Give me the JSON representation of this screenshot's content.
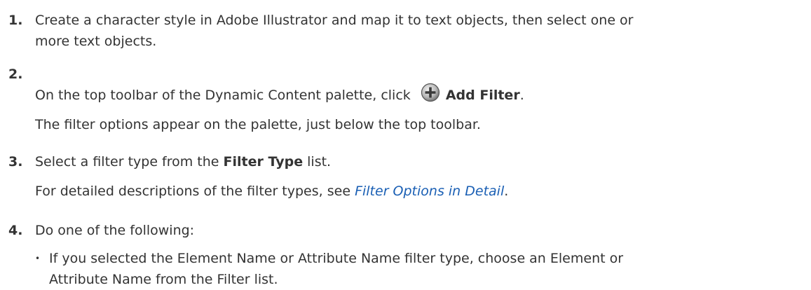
{
  "steps": [
    {
      "number": "1.",
      "lines": [
        "Create a character style in Adobe Illustrator and map it to text objects, then select one or",
        "more text objects."
      ]
    },
    {
      "number": "2.",
      "text_before": "On the top toolbar of the Dynamic Content palette, click",
      "button_label": "Add Filter",
      "text_after": ".",
      "icon": "add-circle-icon",
      "result": "The filter options appear on the palette, just below the top toolbar."
    },
    {
      "number": "3.",
      "text_before": "Select a filter type from the",
      "bold_label": "Filter Type",
      "text_after": "list.",
      "note_before": "For detailed descriptions of the filter types, see",
      "link_text": "Filter Options in Detail",
      "note_after": "."
    },
    {
      "number": "4.",
      "text": "Do one of the following:",
      "bullets": [
        {
          "symbol": "•",
          "lines": [
            "If you selected the Element Name or Attribute Name filter type, choose an Element or",
            "Attribute Name from the Filter list."
          ]
        }
      ]
    }
  ],
  "colors": {
    "text": "#333333",
    "link": "#1a5fb4"
  }
}
